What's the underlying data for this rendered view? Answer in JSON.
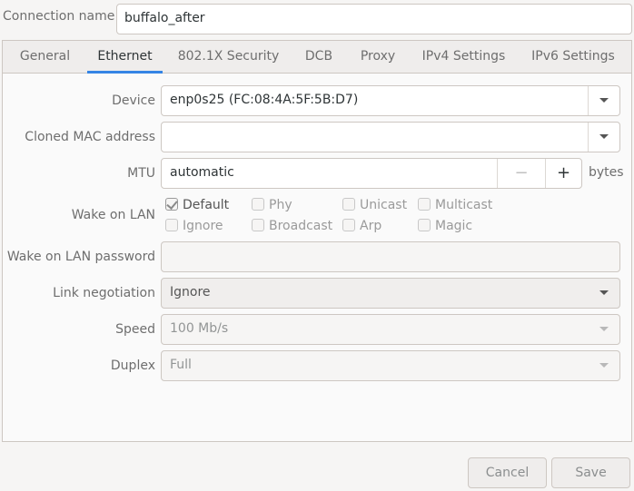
{
  "connection": {
    "label": "Connection name",
    "value": "buffalo_after"
  },
  "tabs": [
    {
      "label": "General"
    },
    {
      "label": "Ethernet"
    },
    {
      "label": "802.1X Security"
    },
    {
      "label": "DCB"
    },
    {
      "label": "Proxy"
    },
    {
      "label": "IPv4 Settings"
    },
    {
      "label": "IPv6 Settings"
    }
  ],
  "active_tab": "Ethernet",
  "form": {
    "device": {
      "label": "Device",
      "value": "enp0s25 (FC:08:4A:5F:5B:D7)"
    },
    "cloned_mac": {
      "label": "Cloned MAC address",
      "value": ""
    },
    "mtu": {
      "label": "MTU",
      "value": "automatic",
      "unit": "bytes",
      "minus": "−",
      "plus": "+"
    },
    "wake_on_lan": {
      "label": "Wake on LAN",
      "options": [
        {
          "label": "Default",
          "checked": true
        },
        {
          "label": "Phy",
          "checked": false
        },
        {
          "label": "Unicast",
          "checked": false
        },
        {
          "label": "Multicast",
          "checked": false
        },
        {
          "label": "Ignore",
          "checked": false
        },
        {
          "label": "Broadcast",
          "checked": false
        },
        {
          "label": "Arp",
          "checked": false
        },
        {
          "label": "Magic",
          "checked": false
        }
      ]
    },
    "wol_password": {
      "label": "Wake on LAN password",
      "value": ""
    },
    "link_negotiation": {
      "label": "Link negotiation",
      "value": "Ignore"
    },
    "speed": {
      "label": "Speed",
      "value": "100 Mb/s"
    },
    "duplex": {
      "label": "Duplex",
      "value": "Full"
    }
  },
  "buttons": {
    "cancel": "Cancel",
    "save": "Save"
  },
  "colors": {
    "accent": "#3584e4",
    "border": "#cdc7c2",
    "label": "#6e6e6e"
  }
}
